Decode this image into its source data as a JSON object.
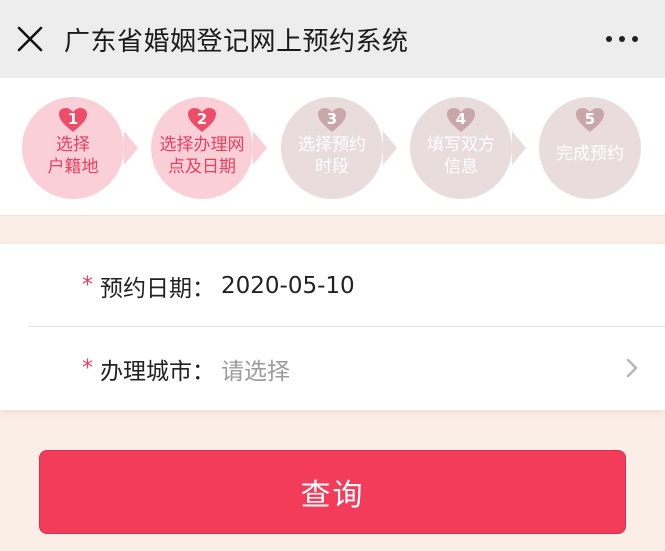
{
  "header": {
    "title": "广东省婚姻登记网上预约系统"
  },
  "steps": [
    {
      "num": "1",
      "label": "选择户籍地",
      "active": true
    },
    {
      "num": "2",
      "label": "选择办理网点及日期",
      "active": true
    },
    {
      "num": "3",
      "label": "选择预约时段",
      "active": false
    },
    {
      "num": "4",
      "label": "填写双方信息",
      "active": false
    },
    {
      "num": "5",
      "label": "完成预约",
      "active": false
    }
  ],
  "step_lines": {
    "s1": [
      "选择",
      "户籍地"
    ],
    "s2": [
      "选择办理网",
      "点及日期"
    ],
    "s3": [
      "选择预约",
      "时段"
    ],
    "s4": [
      "填写双方",
      "信息"
    ],
    "s5": [
      "完成预约"
    ]
  },
  "form": {
    "required_mark": "*",
    "date": {
      "label": "预约日期：",
      "value": "2020-05-10"
    },
    "city": {
      "label": "办理城市：",
      "placeholder": "请选择"
    }
  },
  "query_button": {
    "label": "查询"
  },
  "colors": {
    "accent": "#f23c5a",
    "step_active_bg": "#fbcfd8",
    "step_inactive_bg": "#e9dcdc",
    "page_bg": "#fbeee6"
  },
  "icons": {
    "close": "close-icon",
    "more": "more-icon",
    "heart": "heart-icon",
    "arrow": "chevron-right-icon"
  }
}
